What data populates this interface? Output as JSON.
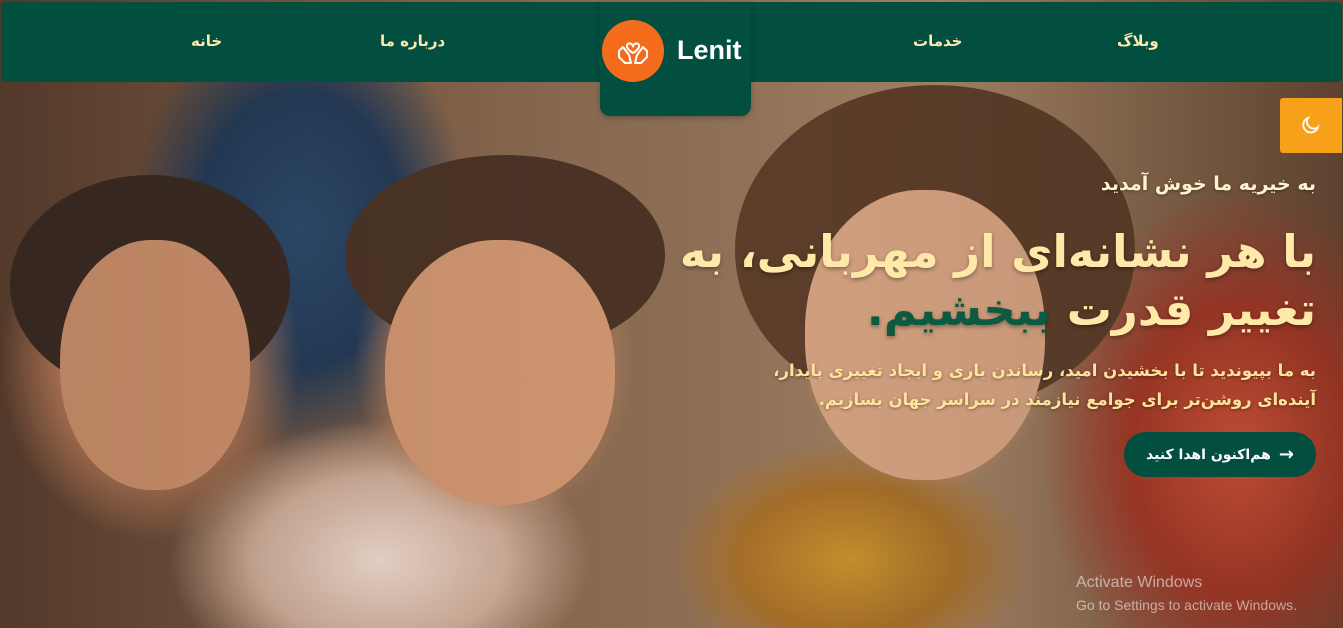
{
  "nav": {
    "home": "خانه",
    "about": "درباره ما",
    "services": "خدمات",
    "blog": "وبلاگ"
  },
  "logo": {
    "text": "Lenit",
    "icon": "heart-hands-icon",
    "circle_color": "#f56b1c"
  },
  "theme_toggle": {
    "icon": "moon-icon"
  },
  "hero": {
    "welcome": "به خیریه ما خوش آمدید",
    "headline_main": "با هر نشانه‌ای از مهربانی، به تغییر قدرت ",
    "headline_accent": "ببخشیم",
    "headline_end": ".",
    "subtext": "به ما بپیوندید تا با بخشیدن امید، رساندن یاری و ایجاد تغییری پایدار، آینده‌ای روشن‌تر برای جوامع نیازمند در سراسر جهان بسازیم.",
    "cta_label": "هم‌اکنون اهدا کنید",
    "cta_icon": "arrow-right-icon"
  },
  "watermark": {
    "title": "Activate Windows",
    "subtitle": "Go to Settings to activate Windows."
  },
  "colors": {
    "primary": "#024e3f",
    "accent_orange": "#f7a11a",
    "cream": "#ffe9a8"
  }
}
